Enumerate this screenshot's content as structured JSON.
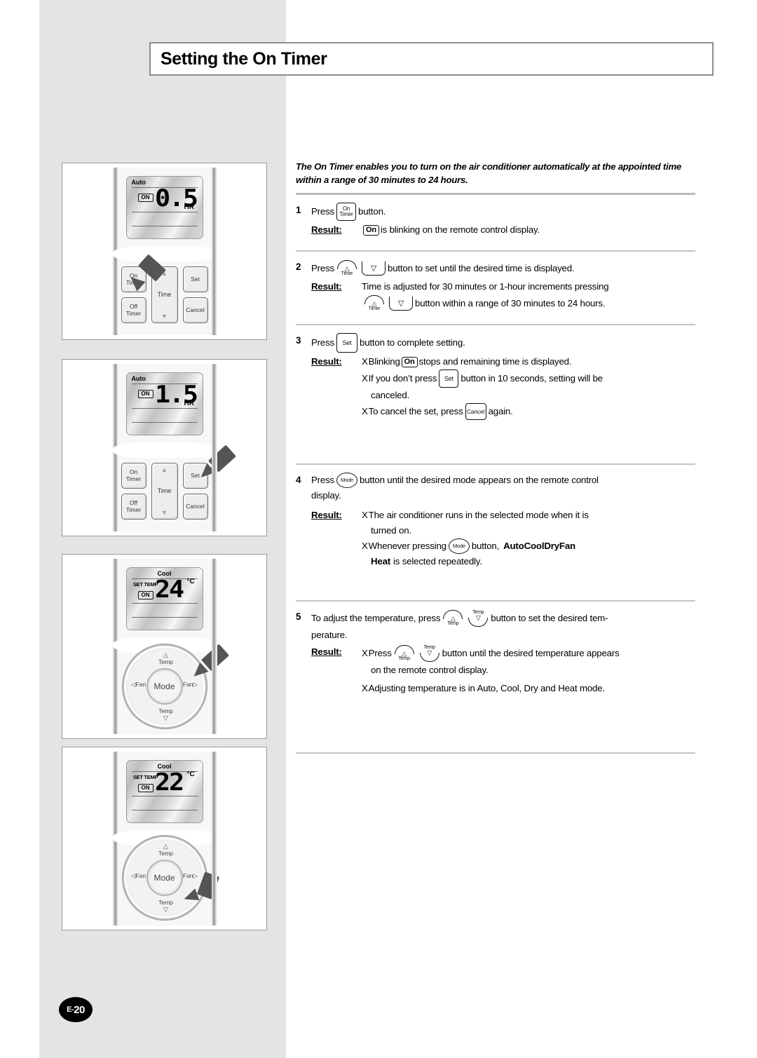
{
  "page": {
    "title": "Setting the On Timer",
    "number_prefix": "E-",
    "number": "20"
  },
  "intro": "The On Timer enables you to turn on the air conditioner automatically at the appointed time within a range of 30 minutes to 24 hours.",
  "labels": {
    "press": "Press",
    "result": "Result:",
    "button_word": "button.",
    "bullet": "X"
  },
  "steps": [
    {
      "num": "1",
      "text_before": "Press",
      "text_after": "button.",
      "result_label": "Result:",
      "result_lines": [
        {
          "before": "",
          "chip": "On",
          "after": "is blinking on the remote control display."
        }
      ]
    },
    {
      "num": "2",
      "text_before": "Press",
      "text_after": "button to set until the desired time is displayed.",
      "result_label": "Result:",
      "result_line_1": "Time is adjusted for 30 minutes or 1-hour increments pressing",
      "result_line_2": "button within a range of 30 minutes to 24 hours."
    },
    {
      "num": "3",
      "text_before": "Press",
      "text_after": "button to complete setting.",
      "result_label": "Result:",
      "b1_before": "Blinking",
      "b1_chip": "On",
      "b1_after": "stops and remaining time is displayed.",
      "b2_before": "If you don’t press",
      "b2_after": "button in 10 seconds, setting will be",
      "b2_cont": "canceled.",
      "b3_before": "To cancel the set, press",
      "b3_after": "again."
    },
    {
      "num": "4",
      "text_before": "Press",
      "text_after": "button until the desired mode appears on the remote control",
      "text_after_2": "display.",
      "result_label": "Result:",
      "b1_line1": "The air conditioner runs in the selected mode when it is",
      "b1_line2": "turned on.",
      "b2_before": "Whenever pressing",
      "b2_after": "button,",
      "modes": [
        "Auto",
        "Cool",
        "Dry",
        "Fan"
      ],
      "mode_last": "Heat",
      "b2_tail": "is selected repeatedly."
    },
    {
      "num": "5",
      "text_before": "To adjust the temperature, press",
      "text_after": "button to set the desired tem-",
      "text_after_2": "perature.",
      "result_label": "Result:",
      "b1_before": "Press",
      "b1_after": "button until the desired temperature appears",
      "b1_cont": "on the remote control display.",
      "b2": "Adjusting temperature is in Auto, Cool, Dry and Heat mode."
    }
  ],
  "glyphs": {
    "on_timer_l1": "On",
    "on_timer_l2": "Timer",
    "off_timer_l1": "Off",
    "off_timer_l2": "Timer",
    "set": "Set",
    "cancel": "Cancel",
    "mode": "Mode",
    "time": "Time",
    "timer_label": "Timer",
    "temp_label": "Temp",
    "fan_label": "Fan",
    "up_triangle": "△",
    "down_triangle": "▽",
    "up_solid": "▲",
    "down_solid": "▼",
    "left_triangle": "◁",
    "right_triangle": "▷",
    "on_chip": "On",
    "on_badge": "ON",
    "set_temp": "SET TEMP",
    "hr_unit": "HR",
    "celsius": "°C"
  },
  "panels": [
    {
      "name": "panel-on-timer-05hr",
      "lcd_mode": "Auto",
      "lcd_mode_align": "left",
      "show_set_temp": false,
      "on_badge": "ON",
      "value": "0.5",
      "unit": "HR",
      "keypad": true,
      "cursor_target": "on-timer-button"
    },
    {
      "name": "panel-on-timer-15hr",
      "lcd_mode": "Auto",
      "lcd_mode_align": "left",
      "show_set_temp": false,
      "on_badge": "ON",
      "value": "1.5",
      "unit": "HR",
      "keypad": true,
      "cursor_target": "set-button"
    },
    {
      "name": "panel-cool-24c",
      "lcd_mode": "Cool",
      "lcd_mode_align": "center",
      "show_set_temp": true,
      "set_temp": "SET TEMP",
      "on_badge": "ON",
      "value": "24",
      "unit": "°C",
      "keypad": false,
      "cursor_target": "mode-dial-button"
    },
    {
      "name": "panel-cool-22c",
      "lcd_mode": "Cool",
      "lcd_mode_align": "center",
      "show_set_temp": true,
      "set_temp": "SET TEMP",
      "on_badge": "ON",
      "value": "22",
      "unit": "°C",
      "keypad": false,
      "cursor_target": "temp-down-button"
    }
  ],
  "colors": {
    "band": "#e4e4e4",
    "rule": "#b8b8b8",
    "border": "#8c8c8c",
    "text": "#000000"
  }
}
